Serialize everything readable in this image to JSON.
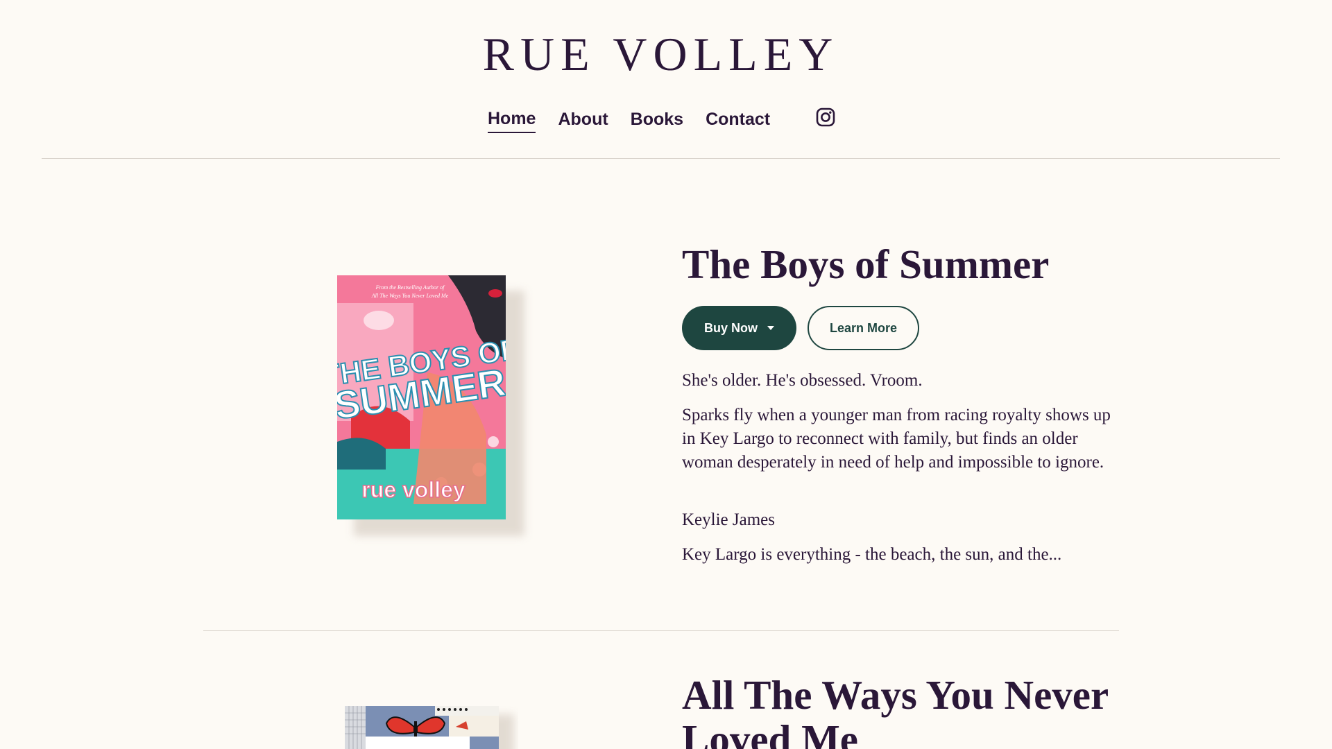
{
  "site": {
    "title": "RUE VOLLEY"
  },
  "nav": {
    "items": [
      {
        "label": "Home",
        "active": true
      },
      {
        "label": "About",
        "active": false
      },
      {
        "label": "Books",
        "active": false
      },
      {
        "label": "Contact",
        "active": false
      }
    ],
    "social_icon": "instagram-icon"
  },
  "books": [
    {
      "title": "The Boys of Summer",
      "buy_label": "Buy Now",
      "learn_label": "Learn More",
      "tagline": "She's older. He's obsessed. Vroom.",
      "blurb": "Sparks fly when a younger man from racing royalty shows up in Key Largo to reconnect with family, but finds an older woman desperately in need of help and impossible to ignore.",
      "character": "Keylie James",
      "excerpt": "Key Largo is everything - the beach, the sun, and the...",
      "cover": {
        "top_line1": "From the Bestselling Author of",
        "top_line2": "All The Ways You Never Loved Me",
        "title_line1": "THE BOYS OF",
        "title_line2": "SUMMER",
        "author": "rue volley",
        "colors": {
          "pink": "#f4789a",
          "teal": "#3cc7b4",
          "title": "#ffffff",
          "title_outline": "#2b8fb0"
        }
      }
    },
    {
      "title": "All The Ways You Never Loved Me",
      "cover": {
        "colors": {
          "blue": "#7b8fb4",
          "butterfly": "#e0362c"
        }
      }
    }
  ],
  "colors": {
    "background": "#fdfaf5",
    "text": "#2a1738",
    "button": "#1e4640"
  }
}
